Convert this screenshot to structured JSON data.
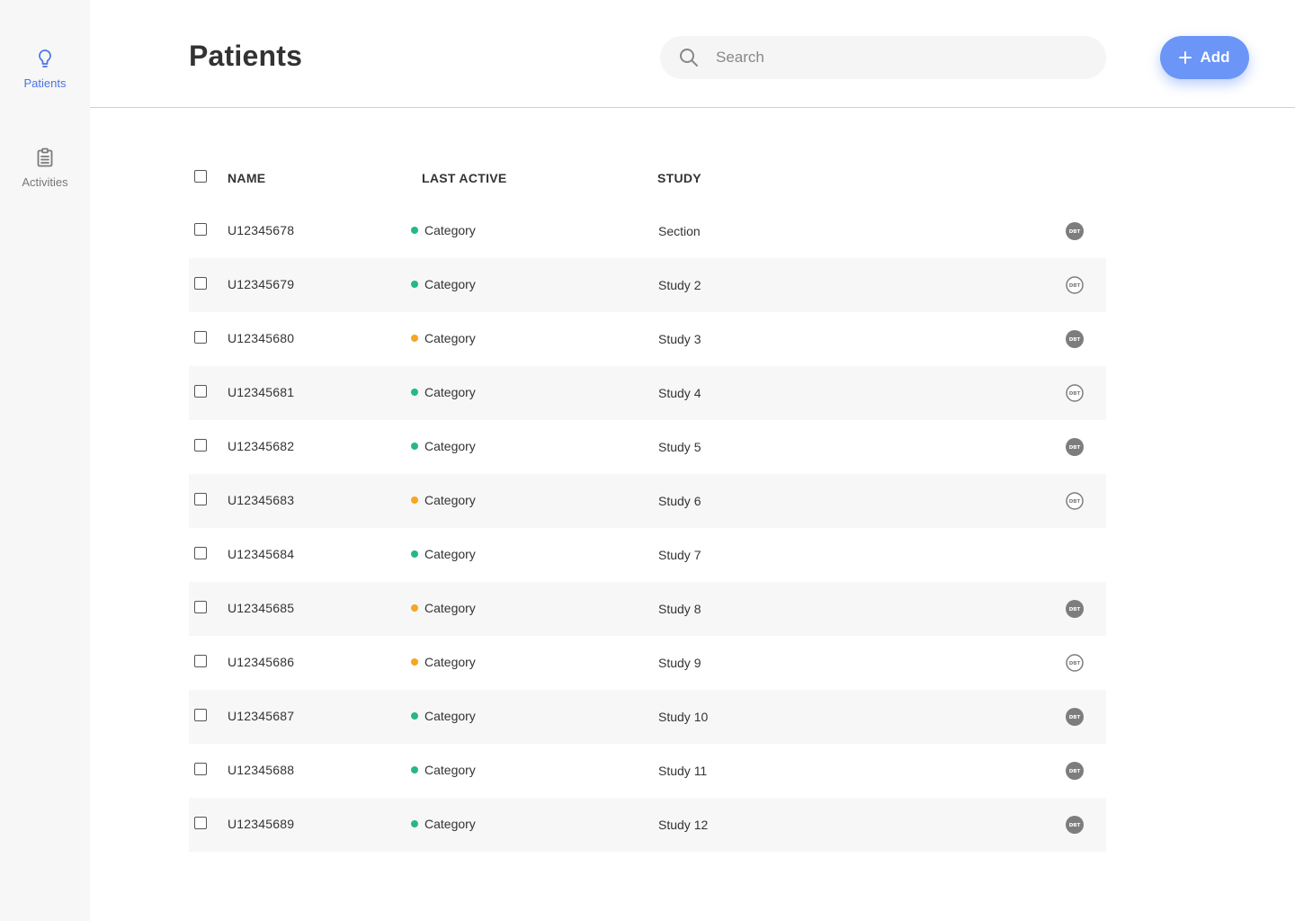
{
  "sidebar": {
    "items": [
      {
        "label": "Patients",
        "icon": "lightbulb-icon",
        "active": true
      },
      {
        "label": "Activities",
        "icon": "clipboard-icon",
        "active": false
      }
    ]
  },
  "header": {
    "title": "Patients",
    "search": {
      "placeholder": "Search",
      "value": ""
    },
    "add_label": "Add"
  },
  "colors": {
    "accent": "#4a73e8",
    "add_button": "#6b95f7",
    "status_green": "#27b882",
    "status_orange": "#f5a623",
    "badge_gray": "#7d7d7d"
  },
  "table": {
    "columns": [
      "NAME",
      "LAST ACTIVE",
      "STUDY"
    ],
    "rows": [
      {
        "name": "U12345678",
        "status": "Category",
        "status_color": "green",
        "study": "Section",
        "badge": "DBT",
        "badge_style": "filled"
      },
      {
        "name": "U12345679",
        "status": "Category",
        "status_color": "green",
        "study": "Study 2",
        "badge": "DBT",
        "badge_style": "outline"
      },
      {
        "name": "U12345680",
        "status": "Category",
        "status_color": "orange",
        "study": "Study 3",
        "badge": "DBT",
        "badge_style": "filled"
      },
      {
        "name": "U12345681",
        "status": "Category",
        "status_color": "green",
        "study": "Study 4",
        "badge": "DBT",
        "badge_style": "outline"
      },
      {
        "name": "U12345682",
        "status": "Category",
        "status_color": "green",
        "study": "Study 5",
        "badge": "DBT",
        "badge_style": "filled"
      },
      {
        "name": "U12345683",
        "status": "Category",
        "status_color": "orange",
        "study": "Study 6",
        "badge": "DBT",
        "badge_style": "outline"
      },
      {
        "name": "U12345684",
        "status": "Category",
        "status_color": "green",
        "study": "Study 7",
        "badge": "",
        "badge_style": "none"
      },
      {
        "name": "U12345685",
        "status": "Category",
        "status_color": "orange",
        "study": "Study 8",
        "badge": "DBT",
        "badge_style": "filled"
      },
      {
        "name": "U12345686",
        "status": "Category",
        "status_color": "orange",
        "study": "Study 9",
        "badge": "DBT",
        "badge_style": "outline"
      },
      {
        "name": "U12345687",
        "status": "Category",
        "status_color": "green",
        "study": "Study 10",
        "badge": "DBT",
        "badge_style": "filled"
      },
      {
        "name": "U12345688",
        "status": "Category",
        "status_color": "green",
        "study": "Study 11",
        "badge": "DBT",
        "badge_style": "filled"
      },
      {
        "name": "U12345689",
        "status": "Category",
        "status_color": "green",
        "study": "Study 12",
        "badge": "DBT",
        "badge_style": "filled"
      }
    ]
  }
}
